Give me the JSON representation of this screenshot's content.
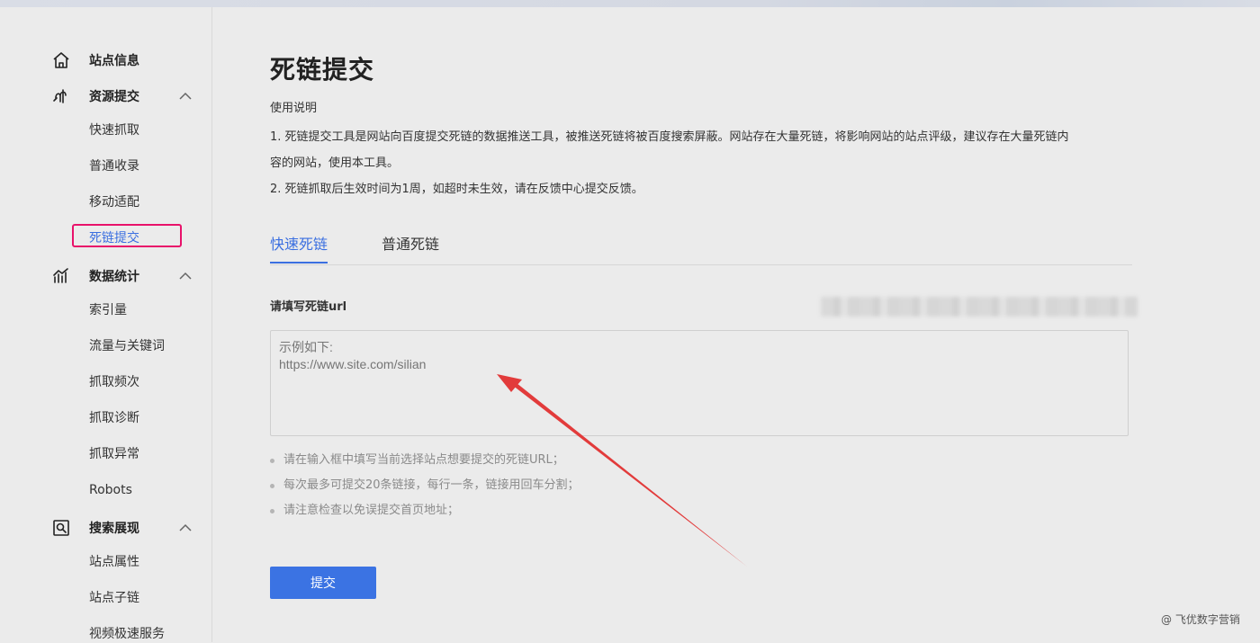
{
  "sidebar": {
    "groups": [
      {
        "label": "站点信息",
        "icon": "home-icon",
        "expandable": false
      },
      {
        "label": "资源提交",
        "icon": "resource-submit-icon",
        "expandable": true
      },
      {
        "label": "数据统计",
        "icon": "stats-chart-icon",
        "expandable": true
      },
      {
        "label": "搜索展现",
        "icon": "search-display-icon",
        "expandable": true
      }
    ],
    "items": [
      "快速抓取",
      "普通收录",
      "移动适配",
      "死链提交",
      "索引量",
      "流量与关键词",
      "抓取频次",
      "抓取诊断",
      "抓取异常",
      "Robots",
      "站点属性",
      "站点子链",
      "视频极速服务"
    ],
    "active_item": "死链提交"
  },
  "main": {
    "title": "死链提交",
    "instructions": {
      "heading": "使用说明",
      "line1": "1. 死链提交工具是网站向百度提交死链的数据推送工具，被推送死链将被百度搜索屏蔽。网站存在大量死链，将影响网站的站点评级，建议存在大量死链内",
      "line1b": "容的网站，使用本工具。",
      "line2": "2. 死链抓取后生效时间为1周，如超时未生效，请在反馈中心提交反馈。"
    },
    "tabs": [
      {
        "label": "快速死链",
        "active": true
      },
      {
        "label": "普通死链",
        "active": false
      }
    ],
    "field_label": "请填写死链url",
    "textarea_placeholder": "示例如下:\nhttps://www.site.com/silian",
    "tips": [
      "请在输入框中填写当前选择站点想要提交的死链URL；",
      "每次最多可提交20条链接，每行一条，链接用回车分割；",
      "请注意检查以免误提交首页地址；"
    ],
    "submit_label": "提交"
  },
  "watermark": "@ 飞优数字营销",
  "colors": {
    "accent": "#3b6fe0",
    "highlight_box": "#e8126a",
    "annotation_arrow": "#e23b3b"
  }
}
